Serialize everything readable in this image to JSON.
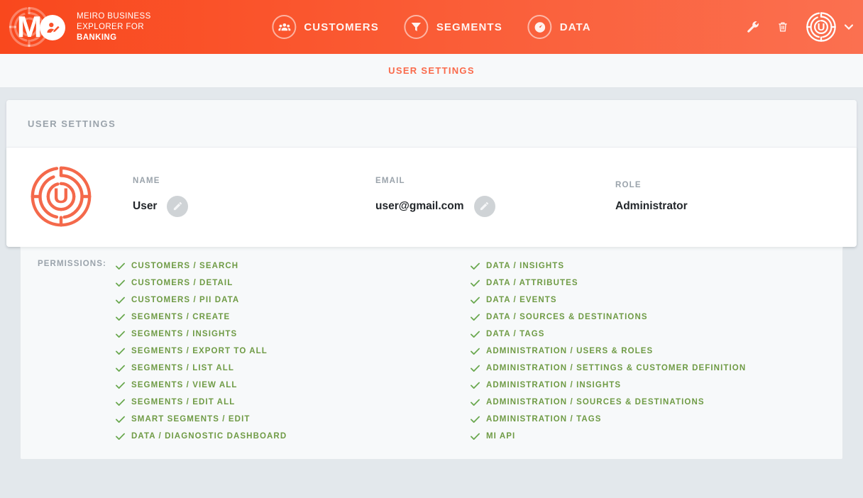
{
  "header": {
    "brand": {
      "logo_letter": "M",
      "line1": "MEIRO BUSINESS",
      "line2": "EXPLORER FOR",
      "line3": "BANKING",
      "badge_icon": "user-edit-icon"
    },
    "nav": [
      {
        "label": "CUSTOMERS",
        "icon": "people-icon"
      },
      {
        "label": "SEGMENTS",
        "icon": "funnel-icon"
      },
      {
        "label": "DATA",
        "icon": "gauge-icon"
      }
    ],
    "actions": [
      {
        "name": "settings-wrench-button",
        "icon": "wrench-icon"
      },
      {
        "name": "delete-button",
        "icon": "trash-icon"
      }
    ],
    "user": {
      "avatar_letter": "U",
      "dropdown_icon": "chevron-down-icon"
    },
    "colors": {
      "gradient_left": "#f9481d",
      "gradient_right": "#fb7050"
    }
  },
  "sub_header": {
    "tab_label": "USER SETTINGS",
    "accent": "#fa6a4b"
  },
  "card": {
    "title": "USER SETTINGS",
    "avatar_letter": "U",
    "fields": [
      {
        "label": "NAME",
        "value": "User",
        "editable": true,
        "edit_icon": "pencil-icon"
      },
      {
        "label": "EMAIL",
        "value": "user@gmail.com",
        "editable": true,
        "edit_icon": "pencil-icon"
      },
      {
        "label": "ROLE",
        "value": "Administrator",
        "editable": false,
        "edit_icon": ""
      }
    ]
  },
  "permissions": {
    "label": "PERMISSIONS:",
    "check_color": "#6aa84f",
    "text_color": "#6f9b45",
    "left_column": [
      "CUSTOMERS / SEARCH",
      "CUSTOMERS / DETAIL",
      "CUSTOMERS / PII DATA",
      "SEGMENTS / CREATE",
      "SEGMENTS / INSIGHTS",
      "SEGMENTS / EXPORT TO ALL",
      "SEGMENTS / LIST ALL",
      "SEGMENTS / VIEW ALL",
      "SEGMENTS / EDIT ALL",
      "SMART SEGMENTS / EDIT",
      "DATA / DIAGNOSTIC DASHBOARD"
    ],
    "right_column": [
      "DATA / INSIGHTS",
      "DATA / ATTRIBUTES",
      "DATA / EVENTS",
      "DATA / SOURCES & DESTINATIONS",
      "DATA / TAGS",
      "ADMINISTRATION / USERS & ROLES",
      "ADMINISTRATION / SETTINGS & CUSTOMER DEFINITION",
      "ADMINISTRATION / INSIGHTS",
      "ADMINISTRATION / SOURCES & DESTINATIONS",
      "ADMINISTRATION / TAGS",
      "MI API"
    ]
  }
}
